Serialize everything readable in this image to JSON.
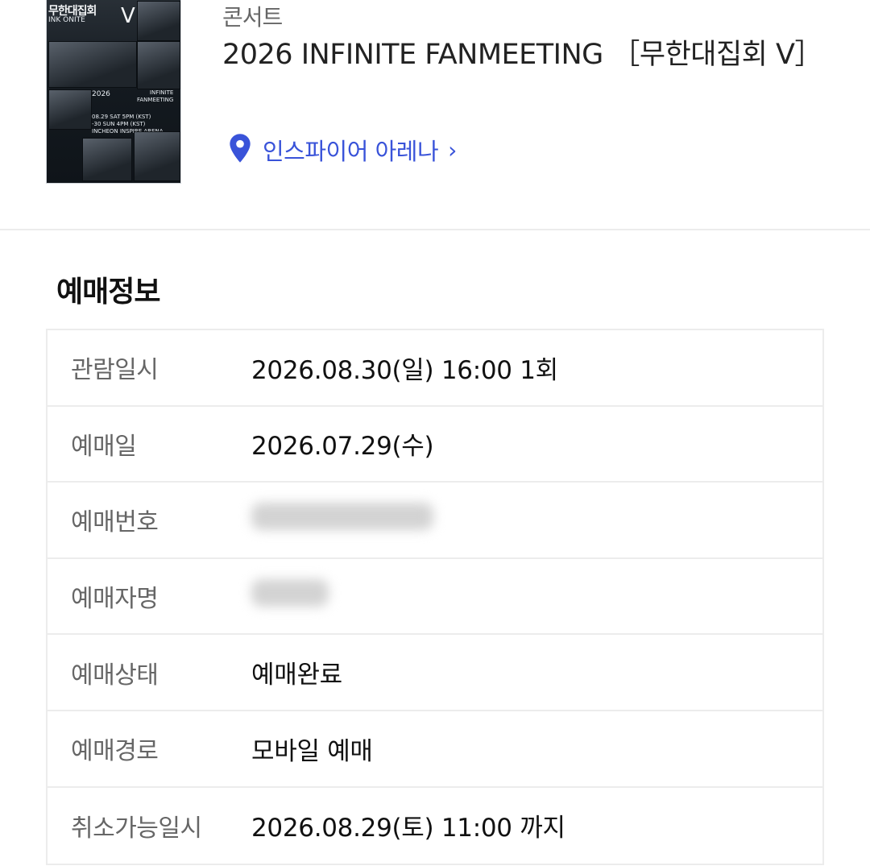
{
  "event": {
    "category": "콘서트",
    "title": "2026 INFINITE FANMEETING ［무한대집회 V］",
    "venue_label": "인스파이어 아레나",
    "venue_chevron": "›",
    "location_icon": "location-pin-icon",
    "accent_color": "#3953d9"
  },
  "poster": {
    "logo_text": "무한대집회",
    "logo_sub": "INK ONITE",
    "logo_v": "V",
    "year": "2026",
    "subtitle_lines": "INFINITE\nFANMEETING",
    "schedule_lines": "08.29 SAT 5PM (KST)\n-30 SUN 4PM (KST)\nINCHEON INSPIRE ARENA"
  },
  "booking_info": {
    "section_title": "예매정보",
    "rows": [
      {
        "label": "관람일시",
        "value": "2026.08.30(일) 16:00 1회"
      },
      {
        "label": "예매일",
        "value": "2026.07.29(수)"
      },
      {
        "label": "예매번호",
        "value": "",
        "blurred": true
      },
      {
        "label": "예매자명",
        "value": "",
        "blurred": true
      },
      {
        "label": "예매상태",
        "value": "예매완료"
      },
      {
        "label": "예매경로",
        "value": "모바일 예매"
      },
      {
        "label": "취소가능일시",
        "value": "2026.08.29(토) 11:00 까지"
      }
    ]
  }
}
